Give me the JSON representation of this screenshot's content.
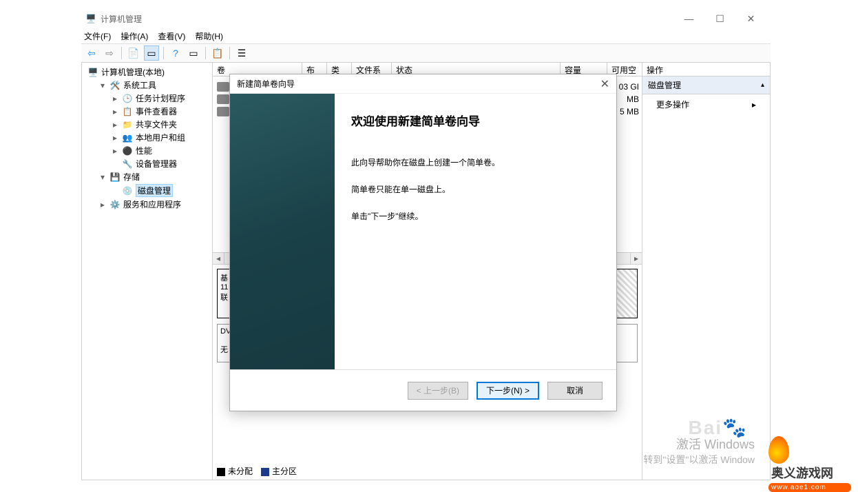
{
  "window": {
    "title": "计算机管理",
    "controls": {
      "min": "—",
      "max": "☐",
      "close": "✕"
    }
  },
  "menubar": [
    "文件(F)",
    "操作(A)",
    "查看(V)",
    "帮助(H)"
  ],
  "toolbar_icons": [
    "back-icon",
    "forward-icon",
    "up-icon",
    "show-hide-icon",
    "help-icon",
    "refresh-icon",
    "export-icon",
    "properties-icon",
    "list-icon"
  ],
  "tree": {
    "root": "计算机管理(本地)",
    "nodes": [
      {
        "label": "系统工具",
        "kind": "group",
        "children": [
          {
            "label": "任务计划程序",
            "icon": "clock-icon"
          },
          {
            "label": "事件查看器",
            "icon": "event-icon"
          },
          {
            "label": "共享文件夹",
            "icon": "share-icon"
          },
          {
            "label": "本地用户和组",
            "icon": "users-icon"
          },
          {
            "label": "性能",
            "icon": "perf-icon"
          },
          {
            "label": "设备管理器",
            "icon": "device-icon"
          }
        ]
      },
      {
        "label": "存储",
        "kind": "group",
        "children": [
          {
            "label": "磁盘管理",
            "icon": "disk-icon",
            "selected": true
          }
        ]
      },
      {
        "label": "服务和应用程序",
        "kind": "group"
      }
    ]
  },
  "grid": {
    "headers": [
      "卷",
      "布局",
      "类型",
      "文件系统",
      "状态",
      "容量",
      "可用空"
    ],
    "rows_visible_suffix": [
      "03 GI",
      "MB",
      "5 MB"
    ]
  },
  "disk_labels": {
    "disk0_type": "基",
    "disk0_size": "11",
    "disk0_state": "联",
    "cd": "DV",
    "cd_state": "无"
  },
  "legend": {
    "unalloc": "未分配",
    "primary": "主分区"
  },
  "actions": {
    "header": "操作",
    "section": "磁盘管理",
    "item": "更多操作"
  },
  "wizard": {
    "title": "新建简单卷向导",
    "heading": "欢迎使用新建简单卷向导",
    "p1": "此向导帮助你在磁盘上创建一个简单卷。",
    "p2": "简单卷只能在单一磁盘上。",
    "p3": "单击\"下一步\"继续。",
    "back": "< 上一步(B)",
    "next": "下一步(N) >",
    "cancel": "取消"
  },
  "watermark": {
    "baidu": "Bai",
    "activate_big": "激活 Windows",
    "activate_small": "转到\"设置\"以激活 Window"
  },
  "brand": {
    "name": "奥义游戏网",
    "url": "www.aoe1.com"
  }
}
